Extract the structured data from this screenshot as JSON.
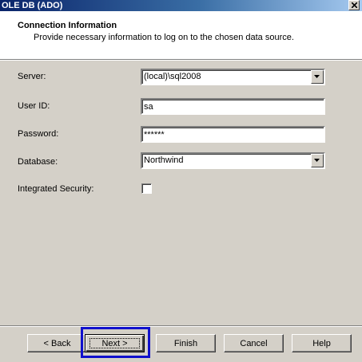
{
  "window": {
    "title": "OLE DB (ADO)"
  },
  "header": {
    "title": "Connection Information",
    "subtitle": "Provide necessary information to log on to the chosen data source."
  },
  "form": {
    "server": {
      "label": "Server:",
      "value": "(local)\\sql2008"
    },
    "user_id": {
      "label": "User ID:",
      "value": "sa"
    },
    "password": {
      "label": "Password:",
      "value": "******"
    },
    "database": {
      "label": "Database:",
      "value": "Northwind"
    },
    "integrated_security": {
      "label": "Integrated Security:",
      "checked": false
    }
  },
  "buttons": {
    "back": "< Back",
    "next": "Next >",
    "finish": "Finish",
    "cancel": "Cancel",
    "help": "Help"
  },
  "colors": {
    "highlight": "#1010cc",
    "title_start": "#0a246a",
    "title_end": "#a6caf0"
  }
}
